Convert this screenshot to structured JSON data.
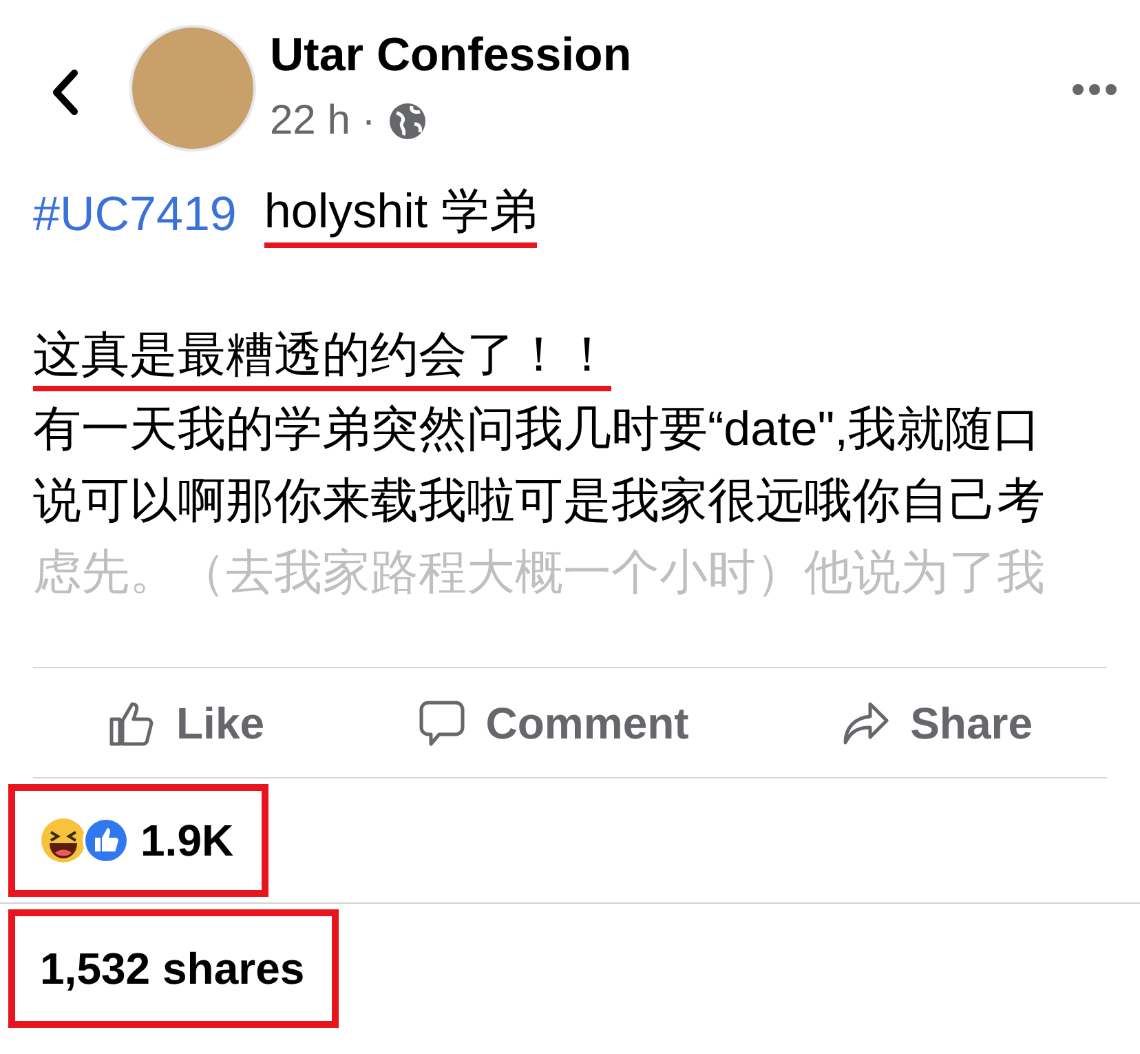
{
  "post": {
    "author": "Utar Confession",
    "time": "22 h ·",
    "title": {
      "hashtag": "#UC7419",
      "text": "holyshit 学弟",
      "highlighted": true
    },
    "body": [
      {
        "text": "这真是最糟透的约会了！！",
        "highlighted": true,
        "faded": false
      },
      {
        "text": "有一天我的学弟突然问我几时要“date\",我就随口",
        "highlighted": false,
        "faded": false
      },
      {
        "text": "说可以啊那你来载我啦可是我家很远哦你自己考",
        "highlighted": false,
        "faded": false
      },
      {
        "text": "虑先。（去我家路程大概一个小时）他说为了我",
        "highlighted": false,
        "faded": true
      }
    ]
  },
  "actions": [
    {
      "kind": "like",
      "label": "Like"
    },
    {
      "kind": "comment",
      "label": "Comment"
    },
    {
      "kind": "share",
      "label": "Share"
    }
  ],
  "reactions": {
    "count": "1.9K",
    "highlighted": true
  },
  "shares": {
    "text": "1,532 shares",
    "highlighted": true
  }
}
